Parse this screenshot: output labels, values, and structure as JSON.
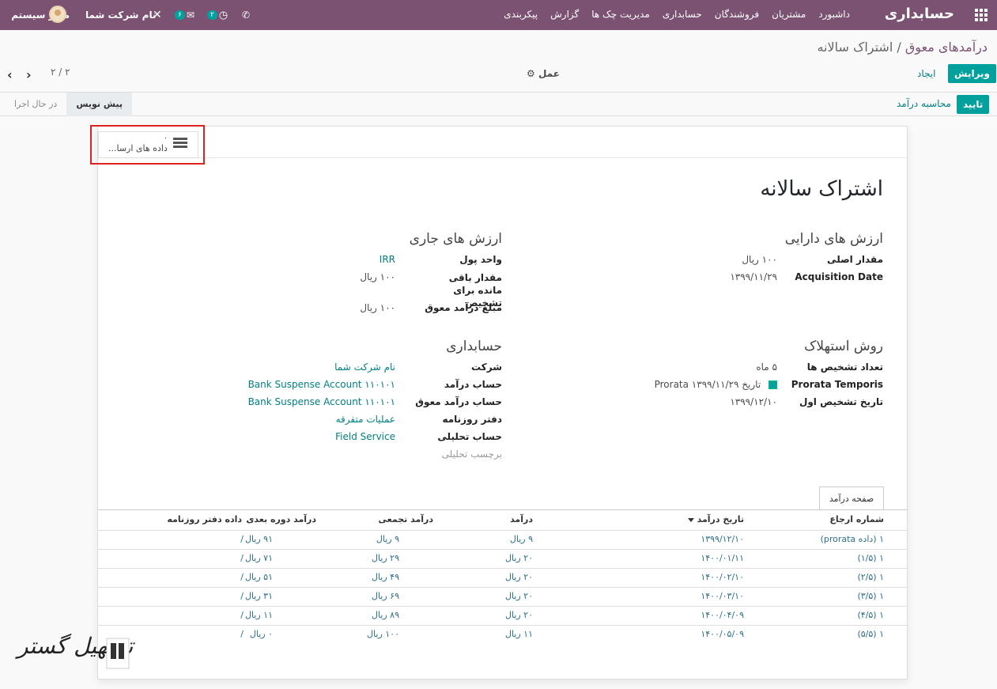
{
  "navbar": {
    "brand": "حسابداری",
    "menu": [
      "داشبورد",
      "مشتریان",
      "فروشندگان",
      "حسابداری",
      "مدیریت چک ها",
      "گزارش",
      "پیکربندی"
    ],
    "user": "مدیر سیستم",
    "company": "نام شرکت شما",
    "messages_count": "۶",
    "activities_count": "۲",
    "brand_color": "#7c5273"
  },
  "breadcrumb": {
    "parent": "درآمدهای معوق",
    "separator": "/",
    "current": "اشتراک سالانه"
  },
  "controls": {
    "edit": "ویرایش",
    "create": "ایجاد",
    "action": "عمل",
    "pager": "۲ / ۲"
  },
  "status": {
    "confirm": "تایید",
    "compute": "محاسبه درآمد",
    "stages": [
      "پیش نویس",
      "در حال اجرا"
    ],
    "active_stage": "پیش نویس"
  },
  "chatter": {
    "count": "۰",
    "label": "داده های ارسا..."
  },
  "form": {
    "title": "اشتراک سالانه",
    "asset_values_title": "ارزش های دارایی",
    "original_value_label": "مقدار اصلی",
    "original_value": "۱۰۰ ریال",
    "acquisition_date_label": "Acquisition Date",
    "acquisition_date": "۱۳۹۹/۱۱/۲۹",
    "current_values_title": "ارزش های جاری",
    "currency_label": "واحد پول",
    "currency": "IRR",
    "residual_label": "مقدار باقی مانده برای تشخیص",
    "residual": "۱۰۰ ریال",
    "deferred_amount_label": "مبلغ درآمد معوق",
    "deferred_amount": "۱۰۰ ریال",
    "method_title": "روش استهلاک",
    "num_recognitions_label": "تعداد تشخیص ها",
    "num_recognitions": "۵ ماه",
    "prorata_label": "Prorata Temporis",
    "prorata": "تاریخ Prorata ۱۳۹۹/۱۱/۲۹",
    "first_recognition_label": "تاریخ تشخیص اول",
    "first_recognition": "۱۳۹۹/۱۲/۱۰",
    "accounting_title": "حسابداری",
    "company_label": "شرکت",
    "company": "نام شرکت شما",
    "revenue_account_label": "حساب درآمد",
    "revenue_account": "Bank Suspense Account ۱۱۰۱۰۱",
    "deferred_account_label": "حساب درآمد معوق",
    "deferred_account": "Bank Suspense Account ۱۱۰۱۰۱",
    "journal_label": "دفتر روزنامه",
    "journal": "عملیات متفرقه",
    "analytic_label": "حساب تحلیلی",
    "analytic": "Field Service",
    "analytic_tag_label": "برچسب تحلیلی"
  },
  "notebook": {
    "tab": "صفحه درآمد",
    "columns": [
      "شماره ارجاع",
      "تاریخ درآمد",
      "درآمد",
      "درآمد تجمعی",
      "درآمد دوره بعدی",
      "داده دفتر روزنامه"
    ],
    "rows": [
      {
        "ref": "۱ (داده prorata)",
        "date": "۱۳۹۹/۱۲/۱۰",
        "revenue": "۹ ریال",
        "cumulative": "۹ ریال",
        "next": "۹۱ ریال",
        "journal": "/"
      },
      {
        "ref": "۱ (۱/۵)",
        "date": "۱۴۰۰/۰۱/۱۱",
        "revenue": "۲۰ ریال",
        "cumulative": "۲۹ ریال",
        "next": "۷۱ ریال",
        "journal": "/"
      },
      {
        "ref": "۱ (۲/۵)",
        "date": "۱۴۰۰/۰۲/۱۰",
        "revenue": "۲۰ ریال",
        "cumulative": "۴۹ ریال",
        "next": "۵۱ ریال",
        "journal": "/"
      },
      {
        "ref": "۱ (۳/۵)",
        "date": "۱۴۰۰/۰۳/۱۰",
        "revenue": "۲۰ ریال",
        "cumulative": "۶۹ ریال",
        "next": "۳۱ ریال",
        "journal": "/"
      },
      {
        "ref": "۱ (۴/۵)",
        "date": "۱۴۰۰/۰۴/۰۹",
        "revenue": "۲۰ ریال",
        "cumulative": "۸۹ ریال",
        "next": "۱۱ ریال",
        "journal": "/"
      },
      {
        "ref": "۱ (۵/۵)",
        "date": "۱۴۰۰/۰۵/۰۹",
        "revenue": "۱۱ ریال",
        "cumulative": "۱۰۰ ریال",
        "next": "۰ ریال",
        "journal": "/"
      }
    ]
  },
  "watermark": "تسهیل گستر"
}
